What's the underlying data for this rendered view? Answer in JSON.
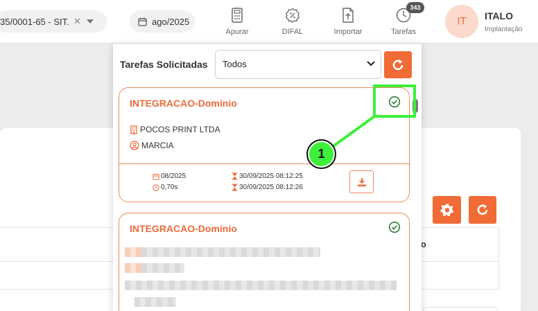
{
  "topbar": {
    "company_text": "35/0001-65 - SIT...",
    "period": "ago/2025",
    "nav": [
      {
        "label": "Apurar",
        "icon": "calculator-icon"
      },
      {
        "label": "DIFAL",
        "icon": "percent-badge-icon"
      },
      {
        "label": "Importar",
        "icon": "file-upload-icon"
      },
      {
        "label": "Tarefas",
        "icon": "clock-icon"
      }
    ],
    "tasks_badge": "343",
    "user": {
      "initials": "IT",
      "name": "ITALO",
      "role": "Implantação"
    }
  },
  "panel": {
    "title": "Tarefas Solicitadas",
    "filter_value": "Todos",
    "tasks": [
      {
        "name": "INTEGRACAO-Domínio",
        "company": "POCOS PRINT LTDA",
        "user": "MARCIA",
        "period": "08/2025",
        "duration": "0,70s",
        "started": "30/09/2025 08:12:25",
        "finished": "30/09/2025 08:12:26"
      },
      {
        "name": "INTEGRACAO-Domínio"
      }
    ]
  },
  "background": {
    "column_header": "ivo"
  },
  "annotation": {
    "marker": "1",
    "color": "#3df03a"
  },
  "colors": {
    "accent": "#f06b35",
    "success": "#2e7d32"
  }
}
